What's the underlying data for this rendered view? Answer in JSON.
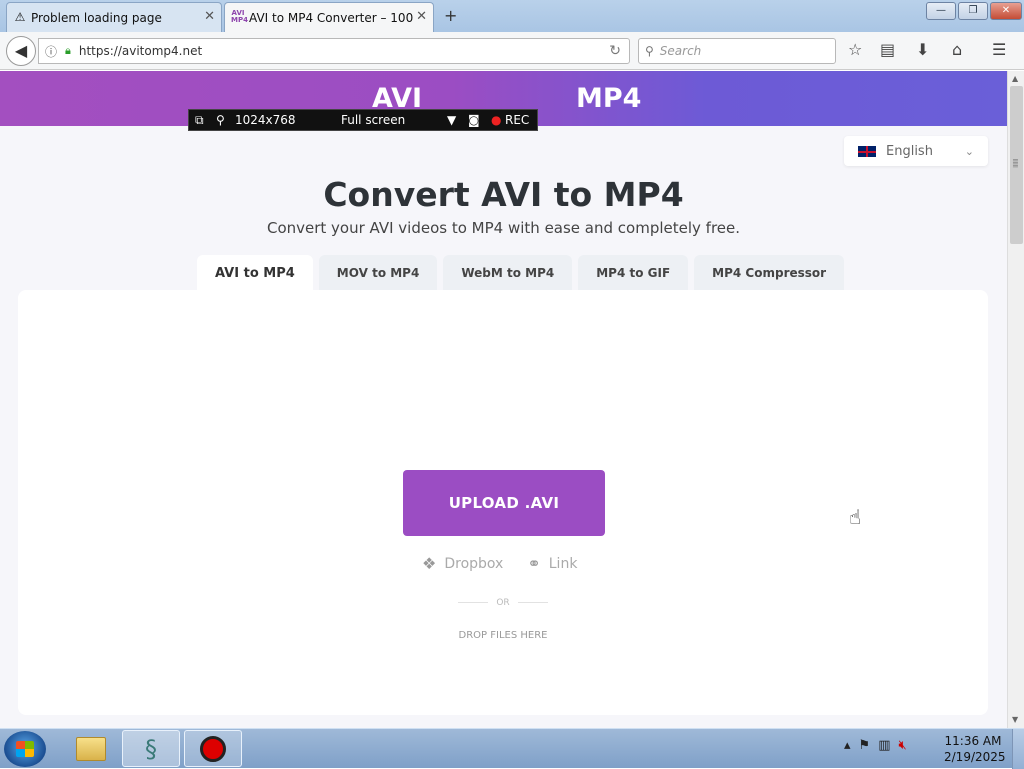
{
  "browser": {
    "tabs": [
      {
        "title": "Problem loading page",
        "icon": "warning-icon",
        "active": false
      },
      {
        "title": "AVI to MP4 Converter – 100",
        "icon": "site-favicon",
        "active": true
      }
    ],
    "favicon_text": "AVI MP4",
    "new_tab_symbol": "+",
    "window_controls": {
      "minimize": "—",
      "maximize": "❐",
      "close": "✕"
    },
    "address": {
      "url": "https://avitomp4.net"
    },
    "search": {
      "placeholder": "Search"
    }
  },
  "recorder_bar": {
    "resolution": "1024x768",
    "mode": "Full screen",
    "rec_label": "REC"
  },
  "page": {
    "banner": {
      "left": "AVI",
      "right": "MP4"
    },
    "language": {
      "selected": "English"
    },
    "title": "Convert AVI to MP4",
    "subtitle": "Convert your AVI videos to MP4 with ease and completely free.",
    "tabs": [
      "AVI to MP4",
      "MOV to MP4",
      "WebM to MP4",
      "MP4 to GIF",
      "MP4 Compressor"
    ],
    "upload_label": "UPLOAD .AVI",
    "dropbox_label": "Dropbox",
    "link_label": "Link",
    "or_label": "OR",
    "drop_label": "DROP FILES HERE"
  },
  "taskbar": {
    "apps": [
      "explorer-icon",
      "python-icon",
      "recorder-icon"
    ],
    "clock_time": "11:36 AM",
    "clock_date": "2/19/2025"
  },
  "colors": {
    "accent": "#9b4dc3",
    "banner_end": "#6a5fd8"
  }
}
